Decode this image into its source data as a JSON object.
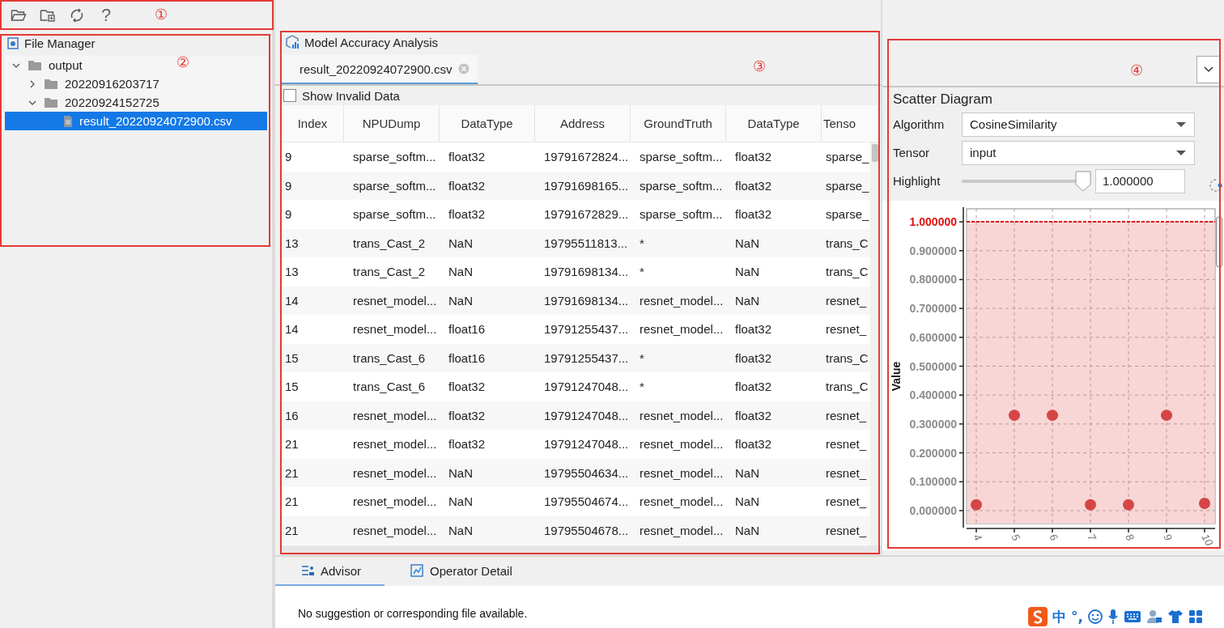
{
  "toolbar": {
    "help_glyph": "?",
    "annotation": "①"
  },
  "file_manager": {
    "title": "File Manager",
    "annotation": "②",
    "tree": [
      {
        "label": "output",
        "kind": "folder",
        "expanded": true,
        "selected": false,
        "children": [
          {
            "label": "20220916203717",
            "kind": "folder",
            "expanded": false,
            "selected": false
          },
          {
            "label": "20220924152725",
            "kind": "folder",
            "expanded": true,
            "selected": false,
            "children": [
              {
                "label": "result_20220924072900.csv",
                "kind": "file",
                "selected": true
              }
            ]
          }
        ]
      }
    ]
  },
  "analysis": {
    "title": "Model Accuracy Analysis",
    "annotation": "③",
    "tabs": [
      {
        "label": "result_20220924072900.csv",
        "selected": true
      }
    ],
    "show_invalid_data": {
      "label": "Show Invalid Data",
      "checked": false
    },
    "table": {
      "columns": [
        "Index",
        "NPUDump",
        "DataType",
        "Address",
        "GroundTruth",
        "DataType",
        "Tenso"
      ],
      "rows": [
        [
          "9",
          "sparse_softm...",
          "float32",
          "19791672824...",
          "sparse_softm...",
          "float32",
          "sparse_"
        ],
        [
          "9",
          "sparse_softm...",
          "float32",
          "19791698165...",
          "sparse_softm...",
          "float32",
          "sparse_"
        ],
        [
          "9",
          "sparse_softm...",
          "float32",
          "19791672829...",
          "sparse_softm...",
          "float32",
          "sparse_"
        ],
        [
          "13",
          "trans_Cast_2",
          "NaN",
          "19795511813...",
          "*",
          "NaN",
          "trans_C"
        ],
        [
          "13",
          "trans_Cast_2",
          "NaN",
          "19791698134...",
          "*",
          "NaN",
          "trans_C"
        ],
        [
          "14",
          "resnet_model...",
          "NaN",
          "19791698134...",
          "resnet_model...",
          "NaN",
          "resnet_"
        ],
        [
          "14",
          "resnet_model...",
          "float16",
          "19791255437...",
          "resnet_model...",
          "float32",
          "resnet_"
        ],
        [
          "15",
          "trans_Cast_6",
          "float16",
          "19791255437...",
          "*",
          "float32",
          "trans_C"
        ],
        [
          "15",
          "trans_Cast_6",
          "float32",
          "19791247048...",
          "*",
          "float32",
          "trans_C"
        ],
        [
          "16",
          "resnet_model...",
          "float32",
          "19791247048...",
          "resnet_model...",
          "float32",
          "resnet_"
        ],
        [
          "21",
          "resnet_model...",
          "float32",
          "19791247048...",
          "resnet_model...",
          "float32",
          "resnet_"
        ],
        [
          "21",
          "resnet_model...",
          "NaN",
          "19795504634...",
          "resnet_model...",
          "NaN",
          "resnet_"
        ],
        [
          "21",
          "resnet_model...",
          "NaN",
          "19795504674...",
          "resnet_model...",
          "NaN",
          "resnet_"
        ],
        [
          "21",
          "resnet_model...",
          "NaN",
          "19795504678...",
          "resnet_model...",
          "NaN",
          "resnet_"
        ]
      ]
    }
  },
  "scatter": {
    "annotation": "④",
    "title": "Scatter Diagram",
    "algorithm": {
      "label": "Algorithm",
      "value": "CosineSimilarity"
    },
    "tensor": {
      "label": "Tensor",
      "value": "input"
    },
    "highlight": {
      "label": "Highlight",
      "level": 1.0,
      "value": "1.000000"
    },
    "chart_data": {
      "type": "scatter",
      "ylabel": "Value",
      "categories": [
        "4",
        "5",
        "6",
        "7",
        "8",
        "9",
        "10"
      ],
      "series": [
        {
          "color": "#d64545",
          "values": [
            0.02,
            0.33,
            0.33,
            0.02,
            0.02,
            0.33,
            0.025
          ]
        }
      ],
      "ylim": [
        -0.045,
        1.045
      ],
      "yticks": [
        {
          "value": 0,
          "label": "0.000000"
        },
        {
          "value": 0.1,
          "label": "0.100000"
        },
        {
          "value": 0.2,
          "label": "0.200000"
        },
        {
          "value": 0.3,
          "label": "0.300000"
        },
        {
          "value": 0.4,
          "label": "0.400000"
        },
        {
          "value": 0.5,
          "label": "0.500000"
        },
        {
          "value": 0.6,
          "label": "0.600000"
        },
        {
          "value": 0.7,
          "label": "0.700000"
        },
        {
          "value": 0.8,
          "label": "0.800000"
        },
        {
          "value": 0.9,
          "label": "0.900000"
        },
        {
          "value": 1,
          "label": "1.000000"
        }
      ],
      "grid": true,
      "ref_lines": [
        {
          "axis": "y",
          "value": 1,
          "color": "#e01010"
        }
      ]
    }
  },
  "bottom": {
    "tabs": [
      {
        "label": "Advisor",
        "selected": true
      },
      {
        "label": "Operator Detail",
        "selected": false
      }
    ],
    "message": "No suggestion or corresponding file available."
  },
  "ime_bar": {
    "texts": [
      "中",
      "°,"
    ]
  }
}
